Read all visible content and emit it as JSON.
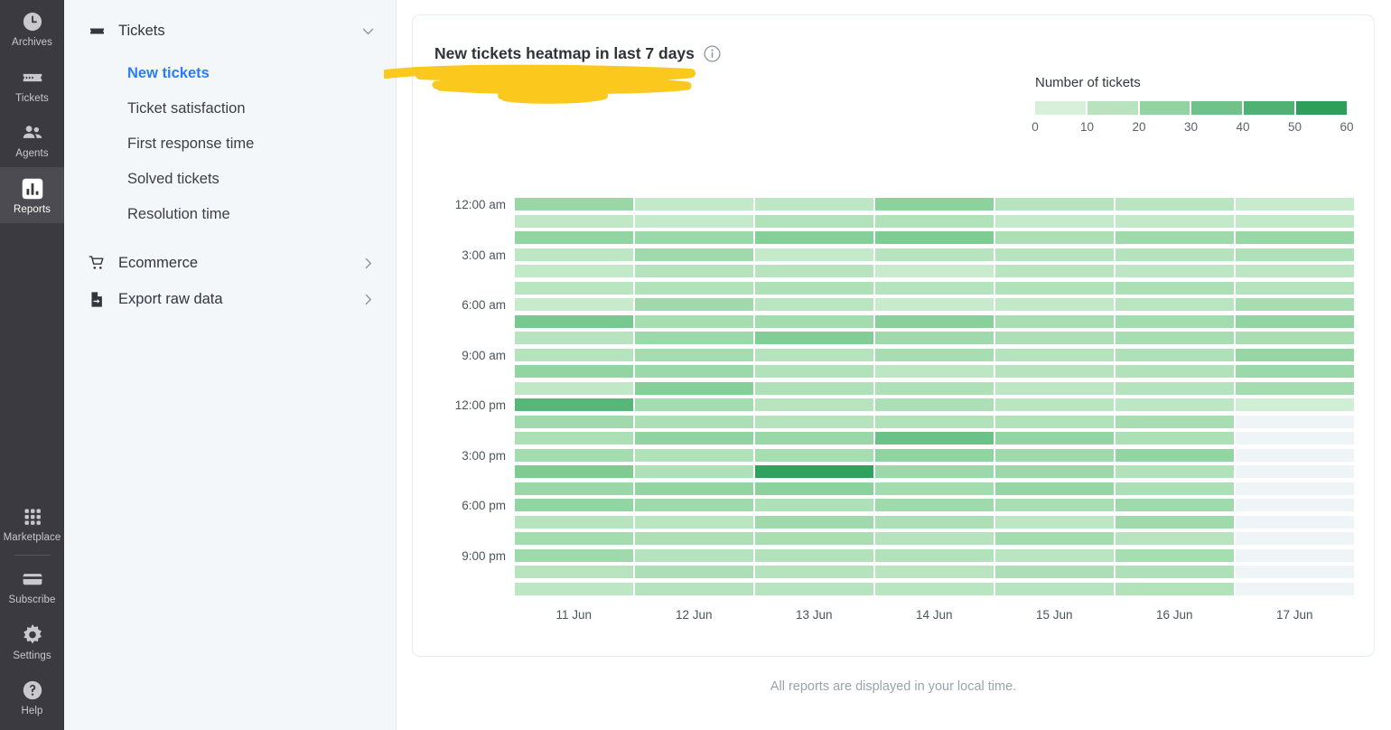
{
  "rail": {
    "items": [
      {
        "label": "Archives",
        "icon": "clock-icon",
        "active": false
      },
      {
        "label": "Tickets",
        "icon": "ticket-icon",
        "active": false
      },
      {
        "label": "Agents",
        "icon": "agents-icon",
        "active": false
      },
      {
        "label": "Reports",
        "icon": "reports-bar-chart-icon",
        "active": true
      }
    ],
    "bottom_items": [
      {
        "label": "Marketplace",
        "icon": "grid-apps-icon"
      },
      {
        "label": "Subscribe",
        "icon": "credit-card-icon"
      },
      {
        "label": "Settings",
        "icon": "gear-icon"
      },
      {
        "label": "Help",
        "icon": "question-circle-icon"
      }
    ]
  },
  "nav": {
    "groups": [
      {
        "label": "Tickets",
        "icon": "ticket-icon",
        "chevron": "chevron-down-icon",
        "expanded": true,
        "children": [
          {
            "label": "New tickets",
            "active": true
          },
          {
            "label": "Ticket satisfaction",
            "active": false
          },
          {
            "label": "First response time",
            "active": false
          },
          {
            "label": "Solved tickets",
            "active": false
          },
          {
            "label": "Resolution time",
            "active": false
          }
        ]
      },
      {
        "label": "Ecommerce",
        "icon": "cart-icon",
        "chevron": "chevron-right-icon",
        "expanded": false,
        "children": []
      },
      {
        "label": "Export raw data",
        "icon": "file-export-icon",
        "chevron": "chevron-right-icon",
        "expanded": false,
        "children": []
      }
    ]
  },
  "card": {
    "title": "New tickets heatmap in last 7 days",
    "info_icon": "info-circle-icon",
    "annotation": "yellow-highlighter-scribble"
  },
  "legend": {
    "title": "Number of tickets",
    "ticks": [
      "0",
      "10",
      "20",
      "30",
      "40",
      "50",
      "60"
    ],
    "swatches": [
      "#d8f0da",
      "#b8e3be",
      "#93d3a2",
      "#6fc289",
      "#4fb173",
      "#2e9e5b"
    ]
  },
  "footnote": "All reports are displayed in your local time.",
  "colors": {
    "accent_blue": "#2a7cf7",
    "rail_bg": "#3b3a40",
    "rail_active": "#4c4b51",
    "panel_bg": "#f4f7f9",
    "empty_cell": "#eff4f6",
    "scale_min": "#e8f7ea",
    "scale_max": "#239a55"
  },
  "chart_data": {
    "type": "heatmap",
    "title": "New tickets heatmap in last 7 days",
    "xlabel": "",
    "ylabel": "",
    "legend_title": "Number of tickets",
    "legend_position": "top-right",
    "grid": false,
    "value_range": [
      0,
      60
    ],
    "colorscale": [
      "#e8f7ea",
      "#239a55"
    ],
    "x_categories": [
      "11 Jun",
      "12 Jun",
      "13 Jun",
      "14 Jun",
      "15 Jun",
      "16 Jun",
      "17 Jun"
    ],
    "y_categories": [
      "12:00 am",
      "1:00 am",
      "2:00 am",
      "3:00 am",
      "4:00 am",
      "5:00 am",
      "6:00 am",
      "7:00 am",
      "8:00 am",
      "9:00 am",
      "10:00 am",
      "11:00 am",
      "12:00 pm",
      "1:00 pm",
      "2:00 pm",
      "3:00 pm",
      "4:00 pm",
      "5:00 pm",
      "6:00 pm",
      "7:00 pm",
      "8:00 pm",
      "9:00 pm",
      "10:00 pm",
      "11:00 pm"
    ],
    "y_tick_labels": [
      "12:00 am",
      "3:00 am",
      "6:00 am",
      "9:00 am",
      "12:00 pm",
      "3:00 pm",
      "6:00 pm",
      "9:00 pm"
    ],
    "y_tick_rows": [
      0,
      3,
      6,
      9,
      12,
      15,
      18,
      21
    ],
    "values": [
      [
        28,
        14,
        16,
        32,
        18,
        17,
        12
      ],
      [
        15,
        13,
        20,
        20,
        13,
        14,
        14
      ],
      [
        30,
        27,
        34,
        36,
        22,
        26,
        28
      ],
      [
        16,
        26,
        13,
        18,
        18,
        19,
        21
      ],
      [
        14,
        19,
        18,
        12,
        17,
        16,
        16
      ],
      [
        17,
        20,
        21,
        19,
        20,
        22,
        19
      ],
      [
        12,
        26,
        17,
        12,
        14,
        17,
        24
      ],
      [
        38,
        24,
        25,
        33,
        23,
        25,
        30
      ],
      [
        18,
        27,
        35,
        26,
        22,
        24,
        23
      ],
      [
        19,
        25,
        19,
        24,
        19,
        21,
        29
      ],
      [
        30,
        27,
        20,
        16,
        18,
        20,
        27
      ],
      [
        15,
        34,
        21,
        21,
        16,
        19,
        25
      ],
      [
        48,
        25,
        18,
        22,
        17,
        16,
        9
      ],
      [
        26,
        22,
        19,
        20,
        20,
        24,
        0
      ],
      [
        22,
        31,
        28,
        42,
        30,
        22,
        0
      ],
      [
        25,
        20,
        24,
        31,
        26,
        30,
        0
      ],
      [
        36,
        21,
        57,
        27,
        27,
        20,
        0
      ],
      [
        28,
        30,
        32,
        25,
        29,
        22,
        0
      ],
      [
        30,
        26,
        21,
        26,
        23,
        26,
        0
      ],
      [
        18,
        17,
        26,
        22,
        16,
        26,
        0
      ],
      [
        25,
        22,
        23,
        19,
        25,
        18,
        0
      ],
      [
        26,
        19,
        20,
        20,
        17,
        24,
        0
      ],
      [
        18,
        22,
        19,
        17,
        22,
        21,
        0
      ],
      [
        16,
        19,
        18,
        17,
        18,
        20,
        0
      ]
    ],
    "null_mask": [
      [
        0,
        0,
        0,
        0,
        0,
        0,
        0
      ],
      [
        0,
        0,
        0,
        0,
        0,
        0,
        0
      ],
      [
        0,
        0,
        0,
        0,
        0,
        0,
        0
      ],
      [
        0,
        0,
        0,
        0,
        0,
        0,
        0
      ],
      [
        0,
        0,
        0,
        0,
        0,
        0,
        0
      ],
      [
        0,
        0,
        0,
        0,
        0,
        0,
        0
      ],
      [
        0,
        0,
        0,
        0,
        0,
        0,
        0
      ],
      [
        0,
        0,
        0,
        0,
        0,
        0,
        0
      ],
      [
        0,
        0,
        0,
        0,
        0,
        0,
        0
      ],
      [
        0,
        0,
        0,
        0,
        0,
        0,
        0
      ],
      [
        0,
        0,
        0,
        0,
        0,
        0,
        0
      ],
      [
        0,
        0,
        0,
        0,
        0,
        0,
        0
      ],
      [
        0,
        0,
        0,
        0,
        0,
        0,
        0
      ],
      [
        0,
        0,
        0,
        0,
        0,
        0,
        1
      ],
      [
        0,
        0,
        0,
        0,
        0,
        0,
        1
      ],
      [
        0,
        0,
        0,
        0,
        0,
        0,
        1
      ],
      [
        0,
        0,
        0,
        0,
        0,
        0,
        1
      ],
      [
        0,
        0,
        0,
        0,
        0,
        0,
        1
      ],
      [
        0,
        0,
        0,
        0,
        0,
        0,
        1
      ],
      [
        0,
        0,
        0,
        0,
        0,
        0,
        1
      ],
      [
        0,
        0,
        0,
        0,
        0,
        0,
        1
      ],
      [
        0,
        0,
        0,
        0,
        0,
        0,
        1
      ],
      [
        0,
        0,
        0,
        0,
        0,
        0,
        1
      ],
      [
        0,
        0,
        0,
        0,
        0,
        0,
        1
      ]
    ]
  }
}
